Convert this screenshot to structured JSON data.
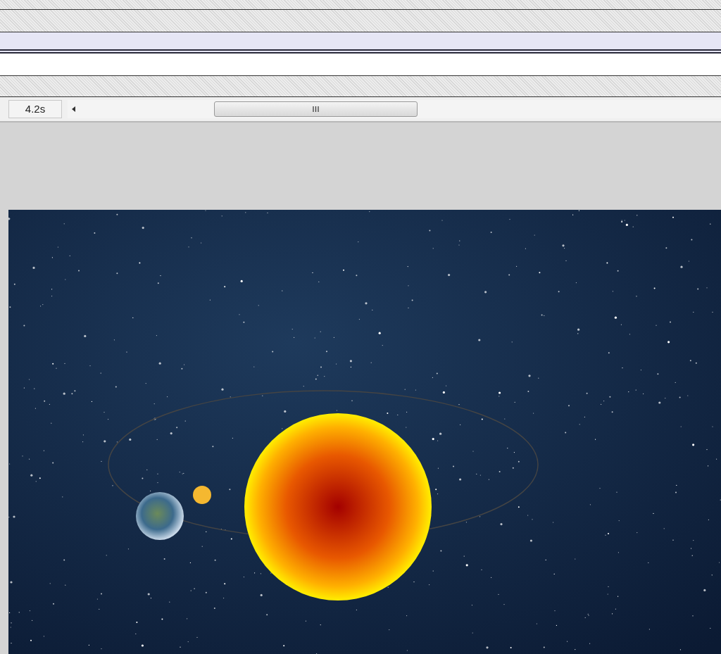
{
  "timeline": {
    "layers": [
      {
        "kind": "empty",
        "selected": false
      },
      {
        "kind": "empty",
        "selected": false
      },
      {
        "kind": "empty",
        "selected": true
      },
      {
        "kind": "filled",
        "selected": false
      },
      {
        "kind": "empty",
        "selected": false
      }
    ],
    "elapsed_time": "4.2s"
  }
}
